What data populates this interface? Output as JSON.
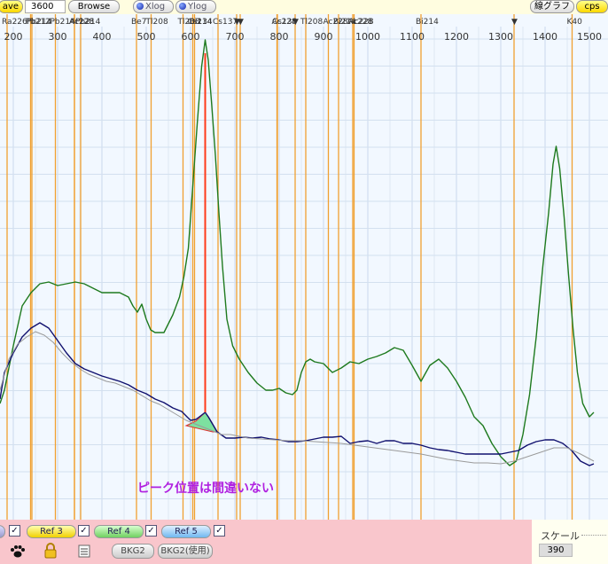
{
  "toolbar": {
    "save_label": "ave",
    "time_value": "3600",
    "browse_label": "Browse",
    "xlog_label": "Xlog",
    "ylog_label": "Ylog",
    "line_graph_label": "線グラフ",
    "cps_label": "cps"
  },
  "chart_data": {
    "type": "line",
    "xlim": [
      170,
      1510
    ],
    "x_ticks": [
      200,
      300,
      400,
      500,
      600,
      700,
      800,
      900,
      1000,
      1100,
      1200,
      1300,
      1400,
      1500
    ],
    "x_tick_labels": [
      "200",
      "300",
      "400",
      "500",
      "600",
      "700",
      "800",
      "900",
      "1000",
      "1100",
      "1200",
      "1300",
      "1400",
      "1500"
    ],
    "grid": true,
    "peak_markers": [
      {
        "label": "Ra226",
        "x": 186
      },
      {
        "label": "Pb212",
        "x": 239
      },
      {
        "label": "Pb214",
        "x": 242
      },
      {
        "label": "Pb214",
        "x": 295
      },
      {
        "label": "Ac228",
        "x": 338
      },
      {
        "label": "Pb214",
        "x": 352
      },
      {
        "label": "Ac228",
        "x": 338
      },
      {
        "label": "Be7",
        "x": 478
      },
      {
        "label": "Tl208",
        "x": 511
      },
      {
        "label": "Tl208",
        "x": 583
      },
      {
        "label": "Bi214",
        "x": 609
      },
      {
        "label": "Cs134",
        "x": 605
      },
      {
        "label": "Cs137",
        "x": 662
      },
      {
        "label": "▼",
        "x": 704
      },
      {
        "label": "▼",
        "x": 712
      },
      {
        "label": "Cs134",
        "x": 796
      },
      {
        "label": "Ac228",
        "x": 795
      },
      {
        "label": "▼",
        "x": 836
      },
      {
        "label": "Tl208",
        "x": 860
      },
      {
        "label": "Ac228",
        "x": 911
      },
      {
        "label": "Bi214",
        "x": 934
      },
      {
        "label": "Ac228",
        "x": 966
      },
      {
        "label": "Ac228",
        "x": 969
      },
      {
        "label": "Bi214",
        "x": 1120
      },
      {
        "label": "▼",
        "x": 1330
      },
      {
        "label": "K40",
        "x": 1461
      }
    ],
    "series": [
      {
        "color": "#1e7a1e",
        "points": [
          [
            170,
            455
          ],
          [
            180,
            440
          ],
          [
            200,
            390
          ],
          [
            220,
            345
          ],
          [
            240,
            330
          ],
          [
            260,
            320
          ],
          [
            280,
            318
          ],
          [
            300,
            322
          ],
          [
            320,
            320
          ],
          [
            340,
            318
          ],
          [
            360,
            320
          ],
          [
            380,
            325
          ],
          [
            400,
            330
          ],
          [
            420,
            330
          ],
          [
            440,
            330
          ],
          [
            460,
            335
          ],
          [
            470,
            345
          ],
          [
            480,
            352
          ],
          [
            490,
            343
          ],
          [
            500,
            360
          ],
          [
            510,
            372
          ],
          [
            520,
            375
          ],
          [
            540,
            375
          ],
          [
            560,
            355
          ],
          [
            575,
            335
          ],
          [
            585,
            312
          ],
          [
            595,
            280
          ],
          [
            605,
            210
          ],
          [
            615,
            140
          ],
          [
            625,
            75
          ],
          [
            633,
            45
          ],
          [
            640,
            68
          ],
          [
            648,
            120
          ],
          [
            656,
            175
          ],
          [
            664,
            240
          ],
          [
            672,
            300
          ],
          [
            682,
            360
          ],
          [
            695,
            390
          ],
          [
            710,
            405
          ],
          [
            730,
            420
          ],
          [
            750,
            432
          ],
          [
            770,
            440
          ],
          [
            785,
            440
          ],
          [
            800,
            438
          ],
          [
            815,
            443
          ],
          [
            830,
            445
          ],
          [
            840,
            440
          ],
          [
            850,
            420
          ],
          [
            860,
            408
          ],
          [
            870,
            405
          ],
          [
            880,
            408
          ],
          [
            900,
            410
          ],
          [
            920,
            420
          ],
          [
            940,
            415
          ],
          [
            960,
            408
          ],
          [
            980,
            410
          ],
          [
            1000,
            405
          ],
          [
            1020,
            402
          ],
          [
            1040,
            398
          ],
          [
            1060,
            392
          ],
          [
            1080,
            395
          ],
          [
            1100,
            412
          ],
          [
            1120,
            430
          ],
          [
            1140,
            412
          ],
          [
            1160,
            405
          ],
          [
            1180,
            415
          ],
          [
            1200,
            430
          ],
          [
            1220,
            448
          ],
          [
            1240,
            470
          ],
          [
            1260,
            480
          ],
          [
            1280,
            500
          ],
          [
            1300,
            515
          ],
          [
            1320,
            525
          ],
          [
            1335,
            520
          ],
          [
            1350,
            490
          ],
          [
            1365,
            445
          ],
          [
            1380,
            380
          ],
          [
            1395,
            300
          ],
          [
            1408,
            240
          ],
          [
            1418,
            185
          ],
          [
            1425,
            165
          ],
          [
            1433,
            190
          ],
          [
            1443,
            245
          ],
          [
            1453,
            310
          ],
          [
            1463,
            370
          ],
          [
            1473,
            420
          ],
          [
            1485,
            455
          ],
          [
            1500,
            470
          ],
          [
            1510,
            465
          ]
        ]
      },
      {
        "color": "#10106e",
        "points": [
          [
            170,
            450
          ],
          [
            180,
            420
          ],
          [
            200,
            398
          ],
          [
            220,
            380
          ],
          [
            240,
            370
          ],
          [
            260,
            364
          ],
          [
            280,
            370
          ],
          [
            300,
            384
          ],
          [
            320,
            398
          ],
          [
            340,
            410
          ],
          [
            360,
            416
          ],
          [
            380,
            420
          ],
          [
            400,
            424
          ],
          [
            420,
            427
          ],
          [
            440,
            430
          ],
          [
            460,
            434
          ],
          [
            480,
            440
          ],
          [
            500,
            444
          ],
          [
            520,
            450
          ],
          [
            540,
            454
          ],
          [
            560,
            460
          ],
          [
            580,
            464
          ],
          [
            600,
            474
          ],
          [
            612,
            473
          ],
          [
            620,
            470
          ],
          [
            633,
            465
          ],
          [
            640,
            470
          ],
          [
            660,
            487
          ],
          [
            680,
            494
          ],
          [
            700,
            494
          ],
          [
            720,
            493
          ],
          [
            740,
            494
          ],
          [
            760,
            493
          ],
          [
            780,
            495
          ],
          [
            800,
            496
          ],
          [
            820,
            498
          ],
          [
            840,
            498
          ],
          [
            860,
            497
          ],
          [
            880,
            495
          ],
          [
            900,
            493
          ],
          [
            920,
            493
          ],
          [
            940,
            492
          ],
          [
            960,
            500
          ],
          [
            980,
            498
          ],
          [
            1000,
            497
          ],
          [
            1020,
            500
          ],
          [
            1040,
            497
          ],
          [
            1060,
            497
          ],
          [
            1080,
            500
          ],
          [
            1100,
            500
          ],
          [
            1120,
            502
          ],
          [
            1140,
            505
          ],
          [
            1160,
            507
          ],
          [
            1180,
            508
          ],
          [
            1200,
            510
          ],
          [
            1220,
            512
          ],
          [
            1240,
            512
          ],
          [
            1260,
            512
          ],
          [
            1280,
            512
          ],
          [
            1300,
            512
          ],
          [
            1320,
            510
          ],
          [
            1340,
            508
          ],
          [
            1360,
            502
          ],
          [
            1380,
            498
          ],
          [
            1400,
            496
          ],
          [
            1420,
            496
          ],
          [
            1440,
            500
          ],
          [
            1460,
            508
          ],
          [
            1480,
            520
          ],
          [
            1500,
            525
          ],
          [
            1510,
            523
          ]
        ]
      },
      {
        "color": "#9a9a9a",
        "points": [
          [
            170,
            440
          ],
          [
            190,
            405
          ],
          [
            210,
            388
          ],
          [
            230,
            380
          ],
          [
            250,
            374
          ],
          [
            270,
            378
          ],
          [
            290,
            386
          ],
          [
            310,
            398
          ],
          [
            330,
            408
          ],
          [
            350,
            416
          ],
          [
            370,
            422
          ],
          [
            390,
            426
          ],
          [
            410,
            430
          ],
          [
            430,
            432
          ],
          [
            450,
            436
          ],
          [
            470,
            440
          ],
          [
            490,
            446
          ],
          [
            510,
            452
          ],
          [
            530,
            456
          ],
          [
            550,
            462
          ],
          [
            570,
            468
          ],
          [
            590,
            474
          ],
          [
            610,
            478
          ],
          [
            630,
            482
          ],
          [
            650,
            486
          ],
          [
            670,
            490
          ],
          [
            690,
            490
          ],
          [
            710,
            492
          ],
          [
            730,
            494
          ],
          [
            760,
            495
          ],
          [
            790,
            496
          ],
          [
            820,
            497
          ],
          [
            850,
            497
          ],
          [
            880,
            498
          ],
          [
            910,
            499
          ],
          [
            940,
            500
          ],
          [
            970,
            502
          ],
          [
            1000,
            504
          ],
          [
            1030,
            506
          ],
          [
            1060,
            508
          ],
          [
            1090,
            510
          ],
          [
            1120,
            512
          ],
          [
            1150,
            515
          ],
          [
            1180,
            518
          ],
          [
            1210,
            520
          ],
          [
            1240,
            522
          ],
          [
            1270,
            522
          ],
          [
            1300,
            523
          ],
          [
            1330,
            520
          ],
          [
            1360,
            515
          ],
          [
            1390,
            510
          ],
          [
            1420,
            505
          ],
          [
            1450,
            505
          ],
          [
            1480,
            512
          ],
          [
            1510,
            520
          ]
        ]
      }
    ],
    "peak_line_x": 633,
    "annotation": "ピーク位置は間違いない"
  },
  "bottom": {
    "ref3_label": "Ref 3",
    "ref4_label": "Ref 4",
    "ref5_label": "Ref 5",
    "bkg2_label": "BKG2",
    "bkg2_use_label": "BKG2(使用)",
    "check_mark": "✓",
    "scale_label": "スケール",
    "scale_value": "390",
    "accent_pink": "#f9c6cc"
  }
}
